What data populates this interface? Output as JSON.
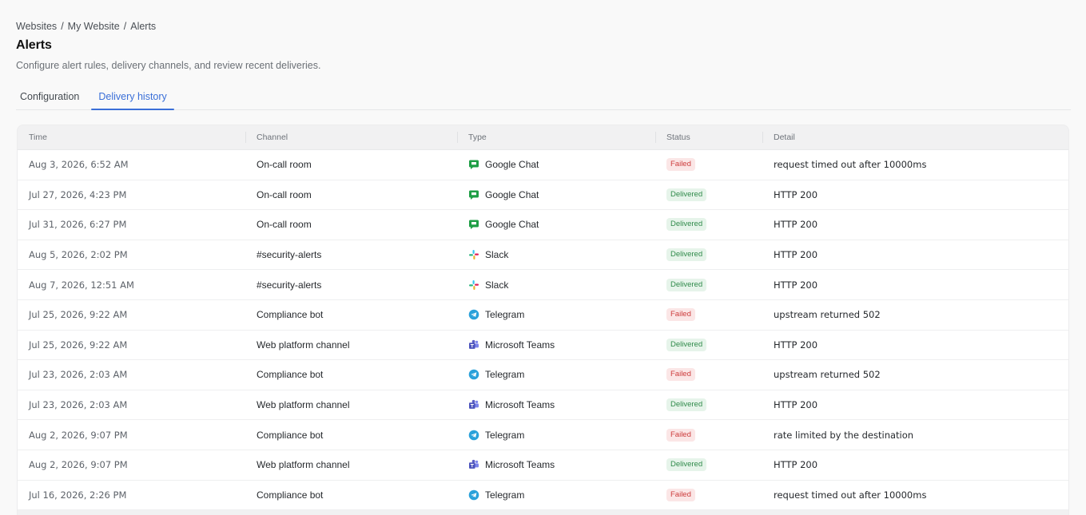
{
  "breadcrumb": {
    "items": [
      "Websites",
      "My Website",
      "Alerts"
    ],
    "separator": "/"
  },
  "page": {
    "title": "Alerts",
    "description": "Configure alert rules, delivery channels, and review recent deliveries."
  },
  "tabs": [
    {
      "label": "Configuration",
      "active": false
    },
    {
      "label": "Delivery history",
      "active": true
    }
  ],
  "table": {
    "headers": {
      "time": "Time",
      "channel": "Channel",
      "type": "Type",
      "status": "Status",
      "detail": "Detail"
    },
    "rows": [
      {
        "time": "Aug 3, 2026, 6:52 AM",
        "channel": "On-call room",
        "type": "Google Chat",
        "icon": "google-chat-icon",
        "status": "Failed",
        "detail": "request timed out after 10000ms"
      },
      {
        "time": "Jul 27, 2026, 4:23 PM",
        "channel": "On-call room",
        "type": "Google Chat",
        "icon": "google-chat-icon",
        "status": "Delivered",
        "detail": "HTTP 200"
      },
      {
        "time": "Jul 31, 2026, 6:27 PM",
        "channel": "On-call room",
        "type": "Google Chat",
        "icon": "google-chat-icon",
        "status": "Delivered",
        "detail": "HTTP 200"
      },
      {
        "time": "Aug 5, 2026, 2:02 PM",
        "channel": "#security-alerts",
        "type": "Slack",
        "icon": "slack-icon",
        "status": "Delivered",
        "detail": "HTTP 200"
      },
      {
        "time": "Aug 7, 2026, 12:51 AM",
        "channel": "#security-alerts",
        "type": "Slack",
        "icon": "slack-icon",
        "status": "Delivered",
        "detail": "HTTP 200"
      },
      {
        "time": "Jul 25, 2026, 9:22 AM",
        "channel": "Compliance bot",
        "type": "Telegram",
        "icon": "telegram-icon",
        "status": "Failed",
        "detail": "upstream returned 502"
      },
      {
        "time": "Jul 25, 2026, 9:22 AM",
        "channel": "Web platform channel",
        "type": "Microsoft Teams",
        "icon": "microsoft-teams-icon",
        "status": "Delivered",
        "detail": "HTTP 200"
      },
      {
        "time": "Jul 23, 2026, 2:03 AM",
        "channel": "Compliance bot",
        "type": "Telegram",
        "icon": "telegram-icon",
        "status": "Failed",
        "detail": "upstream returned 502"
      },
      {
        "time": "Jul 23, 2026, 2:03 AM",
        "channel": "Web platform channel",
        "type": "Microsoft Teams",
        "icon": "microsoft-teams-icon",
        "status": "Delivered",
        "detail": "HTTP 200"
      },
      {
        "time": "Aug 2, 2026, 9:07 PM",
        "channel": "Compliance bot",
        "type": "Telegram",
        "icon": "telegram-icon",
        "status": "Failed",
        "detail": "rate limited by the destination"
      },
      {
        "time": "Aug 2, 2026, 9:07 PM",
        "channel": "Web platform channel",
        "type": "Microsoft Teams",
        "icon": "microsoft-teams-icon",
        "status": "Delivered",
        "detail": "HTTP 200"
      },
      {
        "time": "Jul 16, 2026, 2:26 PM",
        "channel": "Compliance bot",
        "type": "Telegram",
        "icon": "telegram-icon",
        "status": "Failed",
        "detail": "request timed out after 10000ms"
      }
    ]
  },
  "colors": {
    "accent": "#3a6fd8",
    "failed_bg": "#fbe6e6",
    "failed_fg": "#cc3b3b",
    "delivered_bg": "#e6f4ea",
    "delivered_fg": "#2f8a4a",
    "google_chat": "#1e9e45",
    "telegram": "#2aa1da",
    "teams": "#5b5fc7"
  }
}
